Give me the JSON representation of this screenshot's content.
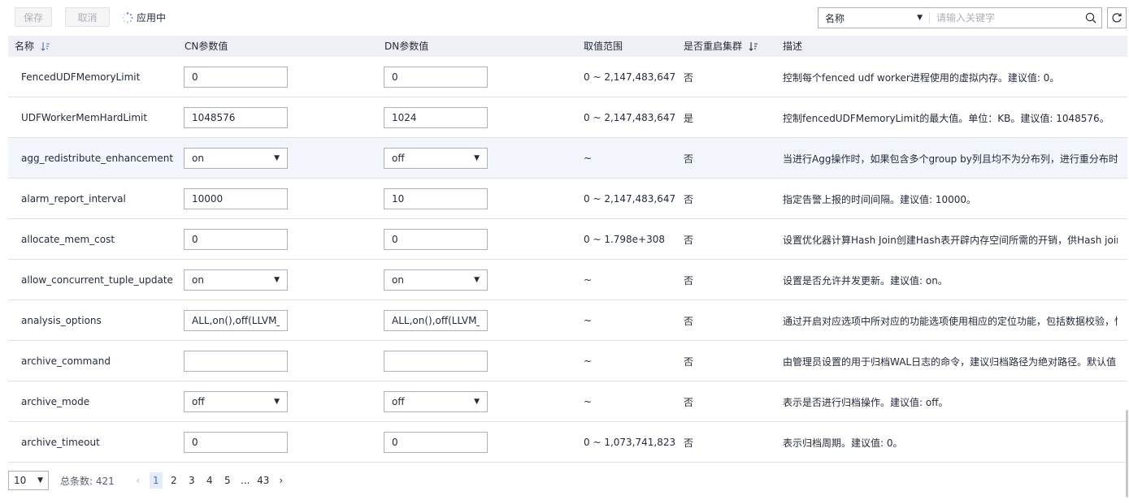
{
  "toolbar": {
    "save_label": "保存",
    "cancel_label": "取消",
    "status_label": "应用中"
  },
  "search": {
    "field_value": "名称",
    "placeholder": "请输入关键字"
  },
  "table": {
    "headers": {
      "name": "名称",
      "cn": "CN参数值",
      "dn": "DN参数值",
      "range": "取值范围",
      "restart": "是否重启集群",
      "desc": "描述"
    },
    "rows": [
      {
        "name": "FencedUDFMemoryLimit",
        "cn_type": "input",
        "cn": "0",
        "dn_type": "input",
        "dn": "0",
        "range": "0 ~ 2,147,483,647",
        "restart": "否",
        "desc": "控制每个fenced udf worker进程使用的虚拟内存。建议值: 0。"
      },
      {
        "name": "UDFWorkerMemHardLimit",
        "cn_type": "input",
        "cn": "1048576",
        "dn_type": "input",
        "dn": "1024",
        "range": "0 ~ 2,147,483,647",
        "restart": "是",
        "desc": "控制fencedUDFMemoryLimit的最大值。单位：KB。建议值: 1048576。"
      },
      {
        "name": "agg_redistribute_enhancement",
        "cn_type": "select",
        "cn": "on",
        "dn_type": "select",
        "dn": "off",
        "range": "~",
        "restart": "否",
        "desc": "当进行Agg操作时，如果包含多个group by列且均不为分布列，进行重分布时会选择某一g..."
      },
      {
        "name": "alarm_report_interval",
        "cn_type": "input",
        "cn": "10000",
        "dn_type": "input",
        "dn": "10",
        "range": "0 ~ 2,147,483,647",
        "restart": "否",
        "desc": "指定告警上报的时间间隔。建议值: 10000。"
      },
      {
        "name": "allocate_mem_cost",
        "cn_type": "input",
        "cn": "0",
        "dn_type": "input",
        "dn": "0",
        "range": "0 ~ 1.798e+308",
        "restart": "否",
        "desc": "设置优化器计算Hash Join创建Hash表开辟内存空间所需的开销，供Hash join估算不准时..."
      },
      {
        "name": "allow_concurrent_tuple_update",
        "cn_type": "select",
        "cn": "on",
        "dn_type": "select",
        "dn": "on",
        "range": "~",
        "restart": "否",
        "desc": "设置是否允许并发更新。建议值: on。"
      },
      {
        "name": "analysis_options",
        "cn_type": "input",
        "cn": "ALL,on(),off(LLVM_COM",
        "dn_type": "input",
        "dn": "ALL,on(),off(LLVM_COM",
        "range": "~",
        "restart": "否",
        "desc": "通过开启对应选项中所对应的功能选项使用相应的定位功能，包括数据校验，性能统计等..."
      },
      {
        "name": "archive_command",
        "cn_type": "input",
        "cn": "",
        "dn_type": "input",
        "dn": "",
        "range": "~",
        "restart": "否",
        "desc": "由管理员设置的用于归档WAL日志的命令，建议归档路径为绝对路径。默认值：不设置。"
      },
      {
        "name": "archive_mode",
        "cn_type": "select",
        "cn": "off",
        "dn_type": "select",
        "dn": "off",
        "range": "~",
        "restart": "否",
        "desc": "表示是否进行归档操作。建议值: off。"
      },
      {
        "name": "archive_timeout",
        "cn_type": "input",
        "cn": "0",
        "dn_type": "input",
        "dn": "0",
        "range": "0 ~ 1,073,741,823",
        "restart": "否",
        "desc": "表示归档周期。建议值: 0。"
      }
    ]
  },
  "pagination": {
    "page_size": "10",
    "total_label": "总条数: 421",
    "pages": [
      "1",
      "2",
      "3",
      "4",
      "5",
      "...",
      "43"
    ],
    "current": "1",
    "prev_icon": "chevron-left-icon",
    "next_icon": "chevron-right-icon"
  },
  "colors": {
    "header_bg": "#eef0f5",
    "highlight_row": "#f2f5fc",
    "active_page": "#526ecc",
    "sort_icon": "#526ecc"
  }
}
